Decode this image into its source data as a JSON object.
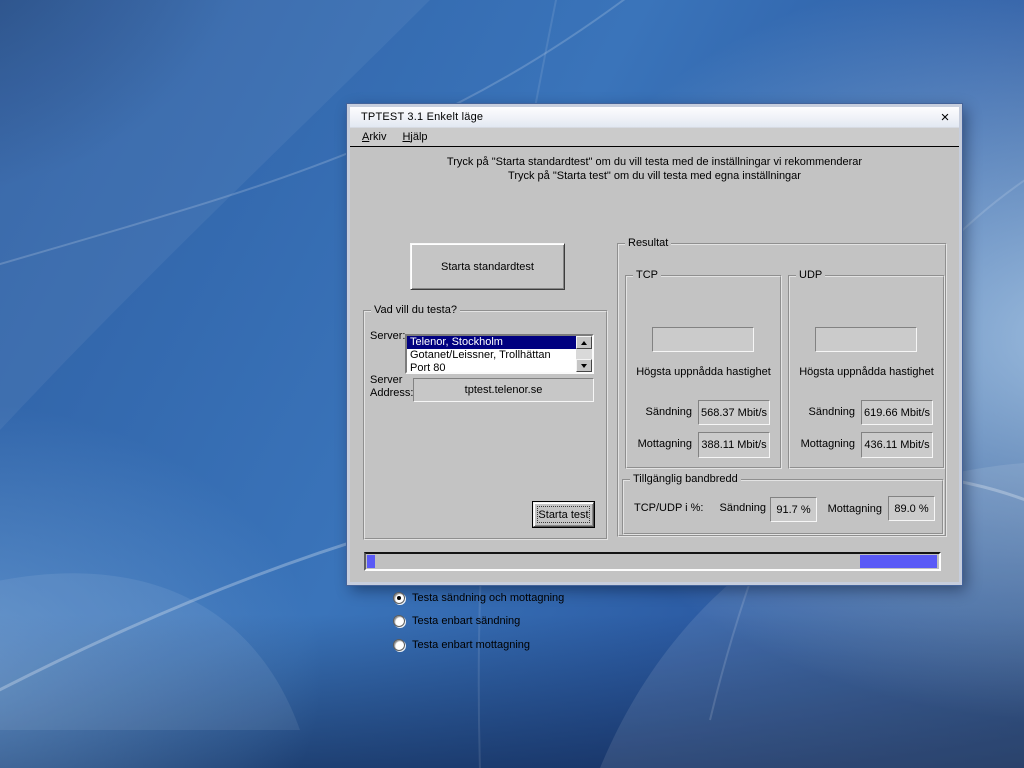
{
  "window": {
    "title": "TPTEST 3.1 Enkelt läge",
    "close_label": "×",
    "menu": [
      {
        "label": "Arkiv"
      },
      {
        "label": "Hjälp"
      }
    ],
    "instructions": [
      "Tryck på \"Starta standardtest\" om du vill testa med de inställningar vi rekommenderar",
      "Tryck på \"Starta test\" om du vill testa med egna inställningar"
    ]
  },
  "standard_test_button": "Starta standardtest",
  "test_panel": {
    "legend": "Vad vill du testa?",
    "server_label": "Server:",
    "server_list": {
      "items": [
        "Telenor, Stockholm",
        "Gotanet/Leissner, Trollhättan",
        "Port 80"
      ],
      "selected_index": 0
    },
    "address_label_line1": "Server",
    "address_label_line2": "Address:",
    "address_value": "tptest.telenor.se",
    "radios": [
      {
        "label": "Testa sändning och mottagning",
        "selected": true
      },
      {
        "label": "Testa enbart sändning",
        "selected": false
      },
      {
        "label": "Testa enbart mottagning",
        "selected": false
      }
    ],
    "start_test_button": "Starta test"
  },
  "results": {
    "legend": "Resultat",
    "tcp": {
      "legend": "TCP",
      "heading": "Högsta uppnådda hastighet",
      "send_label": "Sändning",
      "send_value": "568.37 Mbit/s",
      "recv_label": "Mottagning",
      "recv_value": "388.11 Mbit/s"
    },
    "udp": {
      "legend": "UDP",
      "heading": "Högsta uppnådda hastighet",
      "send_label": "Sändning",
      "send_value": "619.66 Mbit/s",
      "recv_label": "Mottagning",
      "recv_value": "436.11 Mbit/s"
    },
    "bandwidth": {
      "legend": "Tillgänglig bandbredd",
      "ratio_label": "TCP/UDP i %:",
      "send_label": "Sändning",
      "send_value": "91.7 %",
      "recv_label": "Mottagning",
      "recv_value": "89.0 %"
    }
  },
  "progress": {
    "left_segment_pct": 1.4,
    "right_segment_pct": 13.4
  },
  "colors": {
    "selection_bg": "#000080",
    "progress_fill": "#5a5af6",
    "dialog_gray": "#c3c3c3",
    "desktop_blue": "#2e5fa3"
  }
}
